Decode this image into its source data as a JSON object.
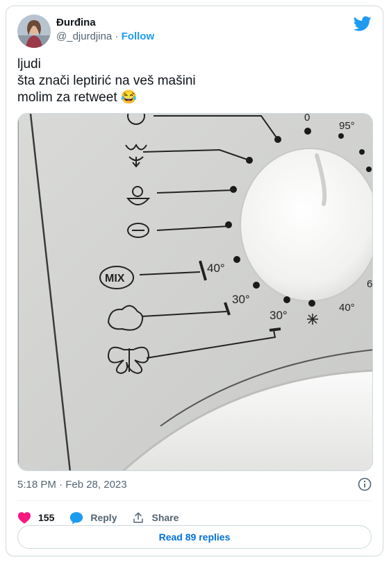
{
  "author": {
    "display_name": "Đurđina",
    "handle": "@_djurdjina",
    "separator": "·",
    "follow_label": "Follow"
  },
  "tweet": {
    "lines": [
      "ljudi",
      "šta znači leptirić na veš mašini",
      "molim za retweet 😂"
    ]
  },
  "photo": {
    "labels": {
      "temp_40_a": "40°",
      "temp_30_a": "30°",
      "temp_30_b": "30°",
      "temp_95": "95°",
      "temp_40_b": "40°",
      "temp_0": "0",
      "temp_60_partial": "6",
      "mix": "MIX"
    }
  },
  "meta": {
    "timestamp": "5:18 PM · Feb 28, 2023"
  },
  "actions": {
    "like_count": "155",
    "reply_label": "Reply",
    "share_label": "Share"
  },
  "read_replies_label": "Read 89 replies",
  "colors": {
    "accent": "#1d9bf0",
    "like": "#f91880",
    "text_secondary": "#536471"
  }
}
